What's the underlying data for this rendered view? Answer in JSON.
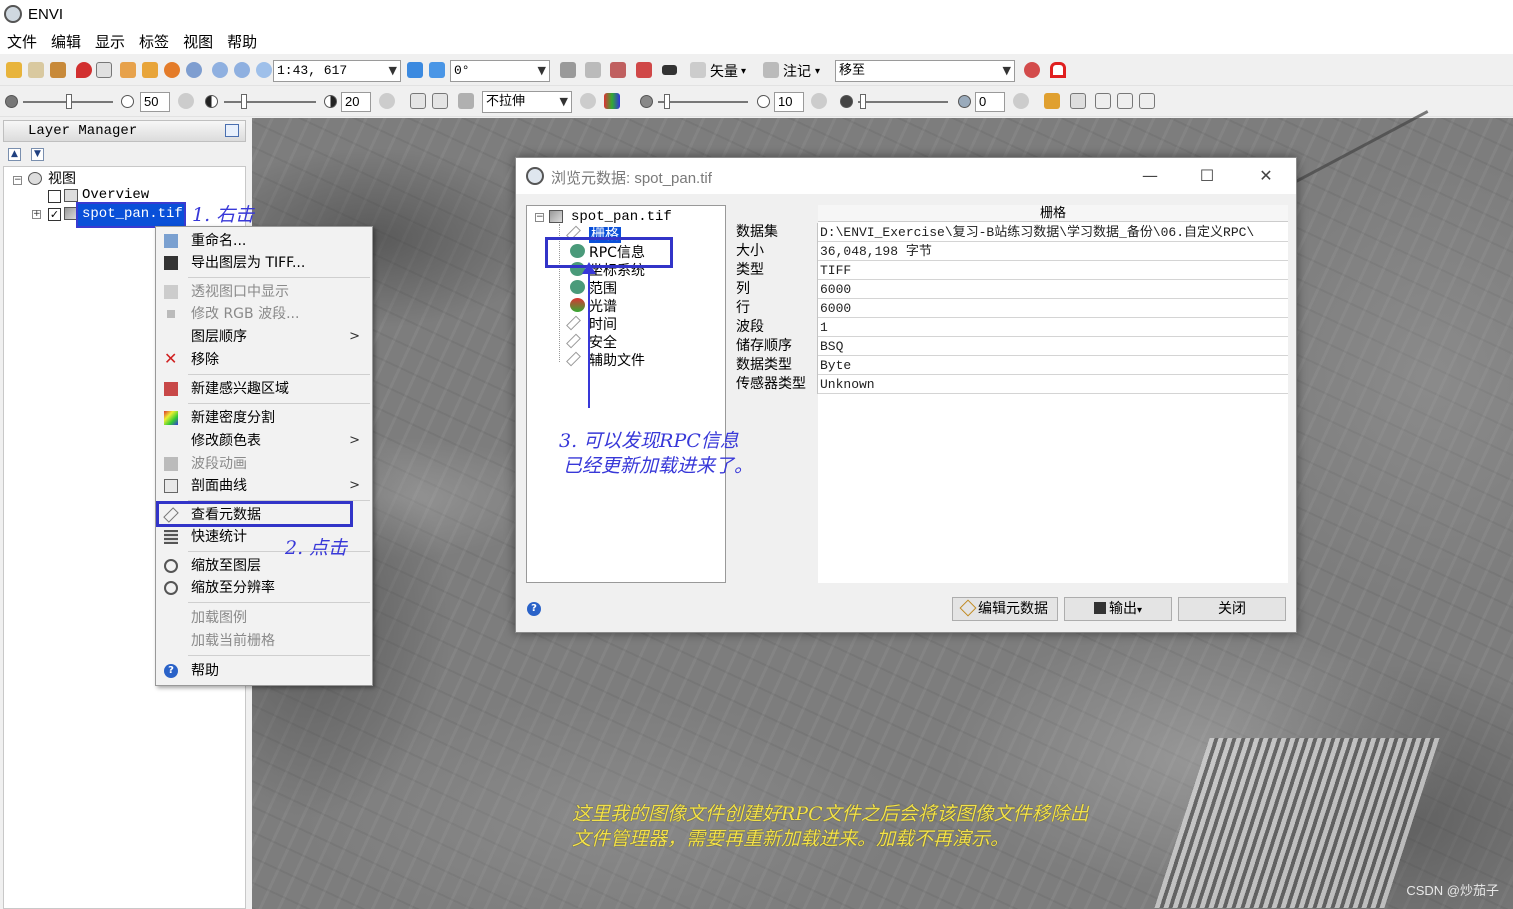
{
  "app": {
    "title": "ENVI"
  },
  "menubar": [
    "文件",
    "编辑",
    "显示",
    "标签",
    "视图",
    "帮助"
  ],
  "toolbar1": {
    "scale_value": "1:43, 617",
    "rotation_value": "0°",
    "vector_label": "矢量",
    "annotation_label": "注记",
    "goto_value": "移至"
  },
  "toolbar2": {
    "brightness_value": "50",
    "contrast_value": "20",
    "stretch_value": "不拉伸",
    "sharpen_value": "10",
    "transparency_value": "0"
  },
  "layer_manager": {
    "title": "Layer Manager",
    "root_label": "视图",
    "overview_label": "Overview",
    "layer_label": "spot_pan.tif"
  },
  "context_menu": {
    "items": [
      {
        "label": "重命名..."
      },
      {
        "label": "导出图层为 TIFF..."
      },
      {
        "label": "透视图口中显示"
      },
      {
        "label": "修改 RGB 波段..."
      },
      {
        "label": "图层顺序"
      },
      {
        "label": "移除"
      },
      {
        "label": "新建感兴趣区域"
      },
      {
        "label": "新建密度分割"
      },
      {
        "label": "修改颜色表"
      },
      {
        "label": "波段动画"
      },
      {
        "label": "剖面曲线"
      },
      {
        "label": "查看元数据"
      },
      {
        "label": "快速统计"
      },
      {
        "label": "缩放至图层"
      },
      {
        "label": "缩放至分辨率"
      },
      {
        "label": "加载图例"
      },
      {
        "label": "加载当前栅格"
      },
      {
        "label": "帮助"
      }
    ]
  },
  "annotations": {
    "step1": "1. 右击",
    "step2": "2. 点击",
    "step3_line1": "3. 可以发现RPC信息",
    "step3_line2": "已经更新加载进来了。",
    "note_line1": "这里我的图像文件创建好RPC文件之后会将该图像文件移除出",
    "note_line2": "文件管理器，需要再重新加载进来。加载不再演示。"
  },
  "metadata_dialog": {
    "title": "浏览元数据: spot_pan.tif",
    "tree_root": "spot_pan.tif",
    "tree_items": [
      "栅格",
      "RPC信息",
      "坐标系统",
      "范围",
      "光谱",
      "时间",
      "安全",
      "辅助文件"
    ],
    "grid_header": "栅格",
    "rows": [
      {
        "key": "数据集",
        "value": "D:\\ENVI_Exercise\\复习-B站练习数据\\学习数据_备份\\06.自定义RPC\\"
      },
      {
        "key": "大小",
        "value": "36,048,198 字节"
      },
      {
        "key": "类型",
        "value": "TIFF"
      },
      {
        "key": "列",
        "value": "6000"
      },
      {
        "key": "行",
        "value": "6000"
      },
      {
        "key": "波段",
        "value": "1"
      },
      {
        "key": "储存顺序",
        "value": "BSQ"
      },
      {
        "key": "数据类型",
        "value": "Byte"
      },
      {
        "key": "传感器类型",
        "value": "Unknown"
      }
    ],
    "buttons": {
      "edit": "编辑元数据",
      "export": "输出",
      "close": "关闭"
    }
  },
  "watermark": "CSDN @炒茄子"
}
